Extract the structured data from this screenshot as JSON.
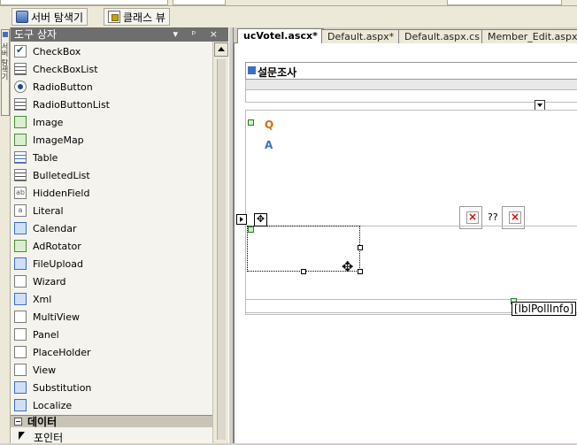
{
  "toolbar": {
    "server_explorer_label": "서버 탐색기",
    "class_view_label": "클래스 뷰"
  },
  "vertical_tab": {
    "label": "서버 탐색기"
  },
  "toolbox": {
    "title": "도구 상자",
    "header_controls": "▾ ᵖ ×",
    "items": [
      {
        "label": "CheckBox",
        "icon": "checkbox-icon"
      },
      {
        "label": "CheckBoxList",
        "icon": "checkboxlist-icon"
      },
      {
        "label": "RadioButton",
        "icon": "radiobutton-icon"
      },
      {
        "label": "RadioButtonList",
        "icon": "radiobuttonlist-icon"
      },
      {
        "label": "Image",
        "icon": "image-icon"
      },
      {
        "label": "ImageMap",
        "icon": "imagemap-icon"
      },
      {
        "label": "Table",
        "icon": "table-icon"
      },
      {
        "label": "BulletedList",
        "icon": "bulletedlist-icon"
      },
      {
        "label": "HiddenField",
        "icon": "hiddenfield-icon"
      },
      {
        "label": "Literal",
        "icon": "literal-icon"
      },
      {
        "label": "Calendar",
        "icon": "calendar-icon"
      },
      {
        "label": "AdRotator",
        "icon": "adrotator-icon"
      },
      {
        "label": "FileUpload",
        "icon": "fileupload-icon"
      },
      {
        "label": "Wizard",
        "icon": "wizard-icon"
      },
      {
        "label": "Xml",
        "icon": "xml-icon"
      },
      {
        "label": "MultiView",
        "icon": "multiview-icon"
      },
      {
        "label": "Panel",
        "icon": "panel-icon"
      },
      {
        "label": "PlaceHolder",
        "icon": "placeholder-icon"
      },
      {
        "label": "View",
        "icon": "view-icon"
      },
      {
        "label": "Substitution",
        "icon": "substitution-icon"
      },
      {
        "label": "Localize",
        "icon": "localize-icon"
      }
    ],
    "category_label": "데이터",
    "pointer_label": "포인터"
  },
  "tabs": [
    {
      "label": "ucVotel.ascx*",
      "active": true
    },
    {
      "label": "Default.aspx*",
      "active": false
    },
    {
      "label": "Default.aspx.cs",
      "active": false
    },
    {
      "label": "Member_Edit.aspx.cs",
      "active": false
    }
  ],
  "design": {
    "title": "설문조사",
    "q_label": "Q",
    "a_label": "A",
    "qq_text": "??",
    "label_control": "[lblPollInfo]"
  }
}
